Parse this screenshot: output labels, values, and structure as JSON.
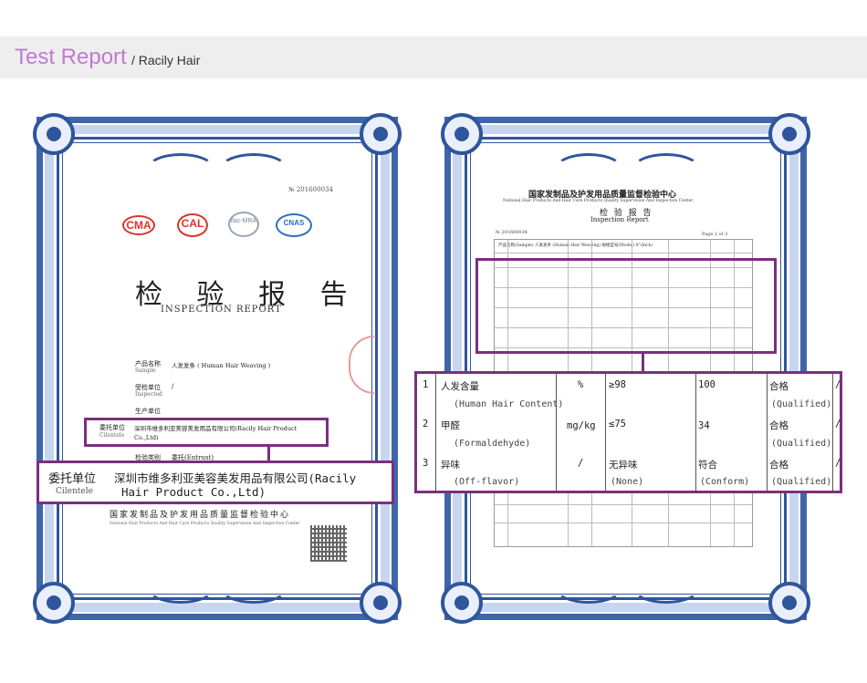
{
  "header": {
    "title": "Test Report",
    "subtitle": "/ Racily Hair"
  },
  "left_cert": {
    "number": "№ 201600034",
    "logos": {
      "ma": "CMA",
      "cal": "CAL",
      "ilac": "ilac-MRA",
      "cnas": "CNAS"
    },
    "title_cn": "检 验 报 告",
    "title_en": "INSPECTION REPORT",
    "fields": [
      {
        "label": "产品名称",
        "sub": "Sample",
        "value": "人发发条 ( Human Hair Weaving )"
      },
      {
        "label": "受检单位",
        "sub": "Inspected",
        "value": "/"
      },
      {
        "label": "生产单位",
        "sub": "",
        "value": ""
      },
      {
        "label": "委托单位",
        "sub": "Cilentele",
        "value": "深圳市维多利亚美容美发用品有限公司(Racily Hair Product Co.,Ltd)"
      },
      {
        "label": "检验类别",
        "sub": "",
        "value": "委托(Entrust)"
      }
    ],
    "footer_cn": "国家发制品及护发用品质量监督检验中心",
    "footer_en": "National Hair Products And Hair Care Products Quality Supervision And Inspection Center",
    "zoom": {
      "label_cn": "委托单位",
      "label_en": "Cilentele",
      "line1": "深圳市维多利亚美容美发用品有限公司(Racily",
      "line2": "Hair Product Co.,Ltd)"
    }
  },
  "right_cert": {
    "header_cn": "国家发制品及护发用品质量监督检验中心",
    "header_en": "National Hair Products And Hair Care Products Quality Supervision And Inspection Center",
    "title_cn": "检 验 报 告",
    "title_en": "Inspection Report",
    "number": "№ 201600034",
    "page": "Page 2 of 3",
    "sample_row": "产品名称(Sample)  人发发条 (Human Hair Weaving)    规格型号(Model) 8\"(Inch)",
    "zoom_rows": [
      {
        "no": "1",
        "item_cn": "人发含量",
        "item_en": "(Human Hair Content)",
        "unit": "%",
        "req": "≥98",
        "result": "100",
        "conclusion_cn": "合格",
        "conclusion_en": "(Qualified)",
        "remark": "/"
      },
      {
        "no": "2",
        "item_cn": "甲醛",
        "item_en": "(Formaldehyde)",
        "unit": "mg/kg",
        "req": "≤75",
        "result": "34",
        "conclusion_cn": "合格",
        "conclusion_en": "(Qualified)",
        "remark": "/"
      },
      {
        "no": "3",
        "item_cn": "异味",
        "item_en": "(Off-flavor)",
        "unit": "/",
        "req": "无异味",
        "req_en": "(None)",
        "result": "符合",
        "result_en": "(Conform)",
        "conclusion_cn": "合格",
        "conclusion_en": "(Qualified)",
        "remark": "/"
      }
    ]
  },
  "colors": {
    "accent": "#7b2f80",
    "frame": "#2f559c",
    "title": "#c07ad0"
  }
}
